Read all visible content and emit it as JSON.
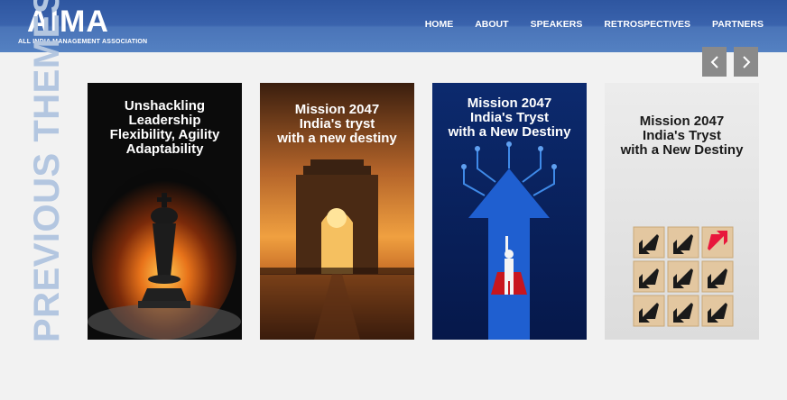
{
  "header": {
    "logo_text": "AIMA",
    "logo_subtitle": "ALL INDIA MANAGEMENT ASSOCIATION",
    "nav": [
      "HOME",
      "ABOUT",
      "SPEAKERS",
      "RETROSPECTIVES",
      "PARTNERS"
    ]
  },
  "section": {
    "title": "PREVIOUS THEMES"
  },
  "cards": [
    {
      "title": "Unshackling\nLeadership\nFlexibility, Agility\nAdaptability"
    },
    {
      "title": "Mission 2047\nIndia's tryst\nwith a new destiny"
    },
    {
      "title": "Mission 2047\nIndia's Tryst\nwith a New Destiny"
    },
    {
      "title": "Mission 2047\nIndia's Tryst\nwith a New Destiny"
    }
  ],
  "colors": {
    "header_blue": "#3a63ad",
    "vertical_title": "#b3c6e0",
    "arrow_button": "#8a8a8a"
  }
}
